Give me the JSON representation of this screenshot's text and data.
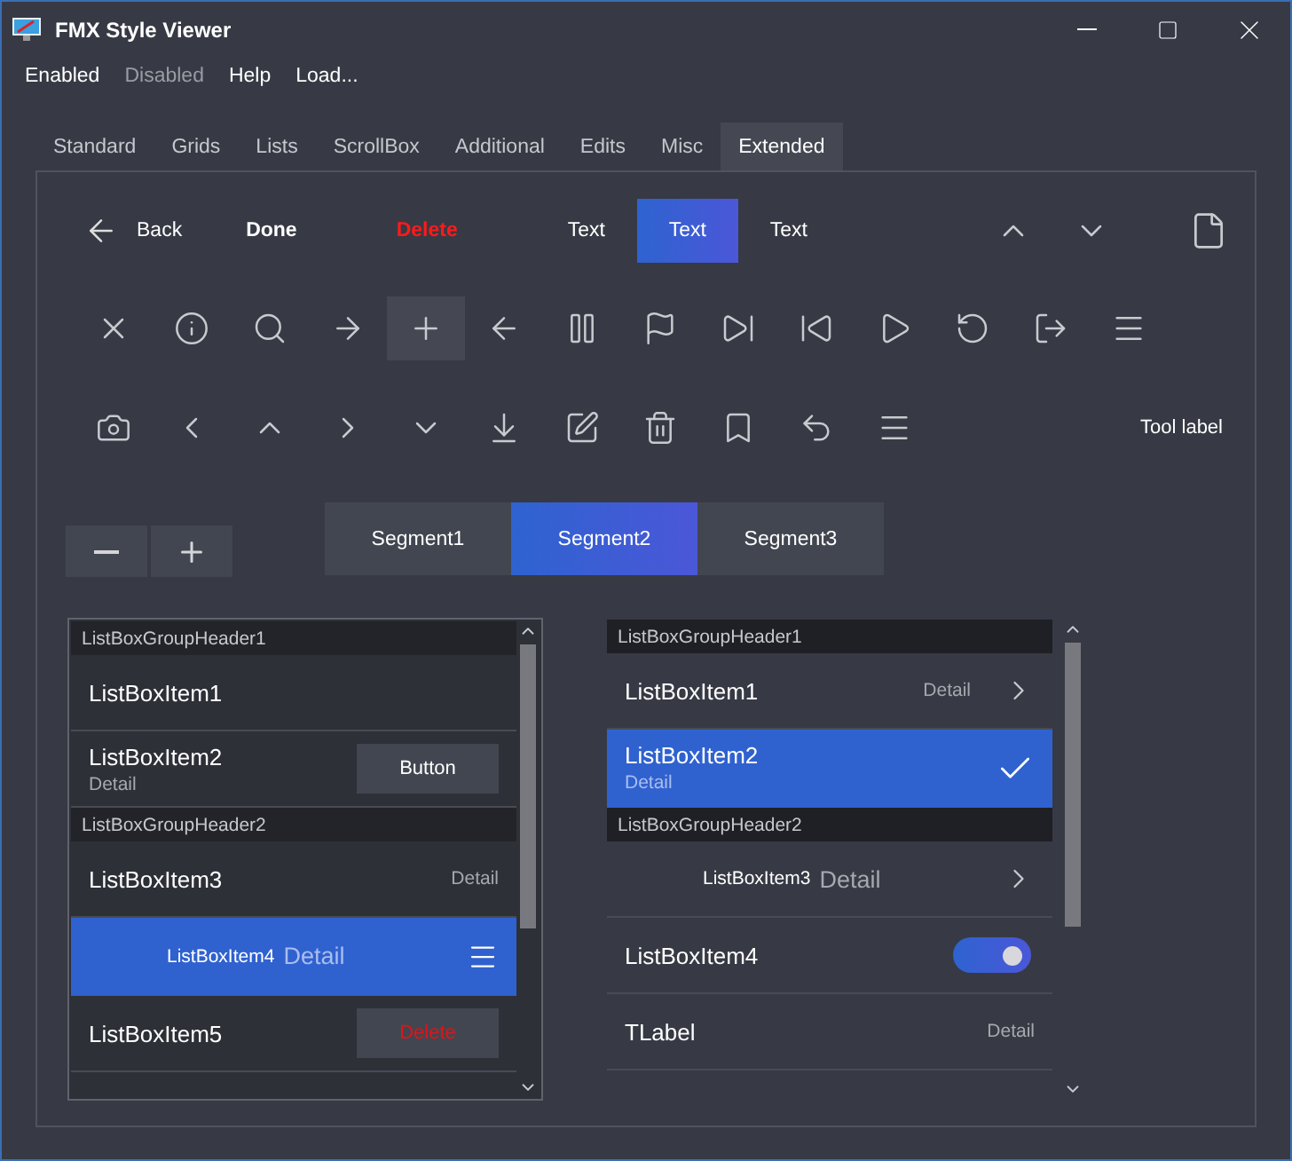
{
  "window": {
    "title": "FMX Style Viewer"
  },
  "menu": [
    {
      "label": "Enabled",
      "disabled": false
    },
    {
      "label": "Disabled",
      "disabled": true
    },
    {
      "label": "Help",
      "disabled": false
    },
    {
      "label": "Load...",
      "disabled": false
    }
  ],
  "tabs": [
    {
      "label": "Standard",
      "selected": false
    },
    {
      "label": "Grids",
      "selected": false
    },
    {
      "label": "Lists",
      "selected": false
    },
    {
      "label": "ScrollBox",
      "selected": false
    },
    {
      "label": "Additional",
      "selected": false
    },
    {
      "label": "Edits",
      "selected": false
    },
    {
      "label": "Misc",
      "selected": false
    },
    {
      "label": "Extended",
      "selected": true
    }
  ],
  "toolbar": {
    "back": "Back",
    "done": "Done",
    "delete": "Delete",
    "text_segments": [
      {
        "label": "Text",
        "selected": false
      },
      {
        "label": "Text",
        "selected": true
      },
      {
        "label": "Text",
        "selected": false
      }
    ]
  },
  "icon_rows": [
    [
      {
        "selected": false
      },
      {
        "selected": false
      },
      {
        "selected": false
      },
      {
        "selected": false
      },
      {
        "selected": true
      },
      {
        "selected": false
      },
      {
        "selected": false
      },
      {
        "selected": false
      },
      {
        "selected": false
      },
      {
        "selected": false
      },
      {
        "selected": false
      },
      {
        "selected": false
      },
      {
        "selected": false
      },
      {
        "selected": false
      }
    ],
    [
      {
        "selected": false
      },
      {
        "selected": false
      },
      {
        "selected": false
      },
      {
        "selected": false
      },
      {
        "selected": false
      },
      {
        "selected": false
      },
      {
        "selected": false
      },
      {
        "selected": false
      },
      {
        "selected": false
      },
      {
        "selected": false
      },
      {
        "selected": false
      }
    ]
  ],
  "tool_label": "Tool label",
  "segments": [
    {
      "label": "Segment1",
      "selected": false
    },
    {
      "label": "Segment2",
      "selected": true
    },
    {
      "label": "Segment3",
      "selected": false
    }
  ],
  "left_list": [
    {
      "kind": "header",
      "text": "ListBoxGroupHeader1"
    },
    {
      "kind": "plain",
      "text": "ListBoxItem1",
      "selected": false
    },
    {
      "kind": "subtitle",
      "text": "ListBoxItem2",
      "detail": "Detail",
      "accessory": {
        "kind": "button",
        "label": "Button"
      },
      "selected": false
    },
    {
      "kind": "header",
      "text": "ListBoxGroupHeader2"
    },
    {
      "kind": "right",
      "text": "ListBoxItem3",
      "detail": "Detail",
      "selected": false
    },
    {
      "kind": "inline",
      "text": "ListBoxItem4",
      "detail": "Detail",
      "accessory": {
        "kind": "menu"
      },
      "selected": true
    },
    {
      "kind": "plain",
      "text": "ListBoxItem5",
      "accessory": {
        "kind": "delete",
        "label": "Delete"
      },
      "selected": false
    }
  ],
  "right_list": [
    {
      "kind": "header",
      "text": "ListBoxGroupHeader1"
    },
    {
      "kind": "right",
      "text": "ListBoxItem1",
      "detail": "Detail",
      "accessory": {
        "kind": "chevron"
      },
      "selected": false
    },
    {
      "kind": "subtitle",
      "text": "ListBoxItem2",
      "detail": "Detail",
      "accessory": {
        "kind": "check"
      },
      "selected": true
    },
    {
      "kind": "header",
      "text": "ListBoxGroupHeader2"
    },
    {
      "kind": "inline",
      "text": "ListBoxItem3",
      "detail": "Detail",
      "accessory": {
        "kind": "chevron"
      },
      "selected": false
    },
    {
      "kind": "plain",
      "text": "ListBoxItem4",
      "accessory": {
        "kind": "switch",
        "on": true
      },
      "selected": false
    },
    {
      "kind": "right",
      "text": "TLabel",
      "detail": "Detail",
      "selected": false
    }
  ]
}
